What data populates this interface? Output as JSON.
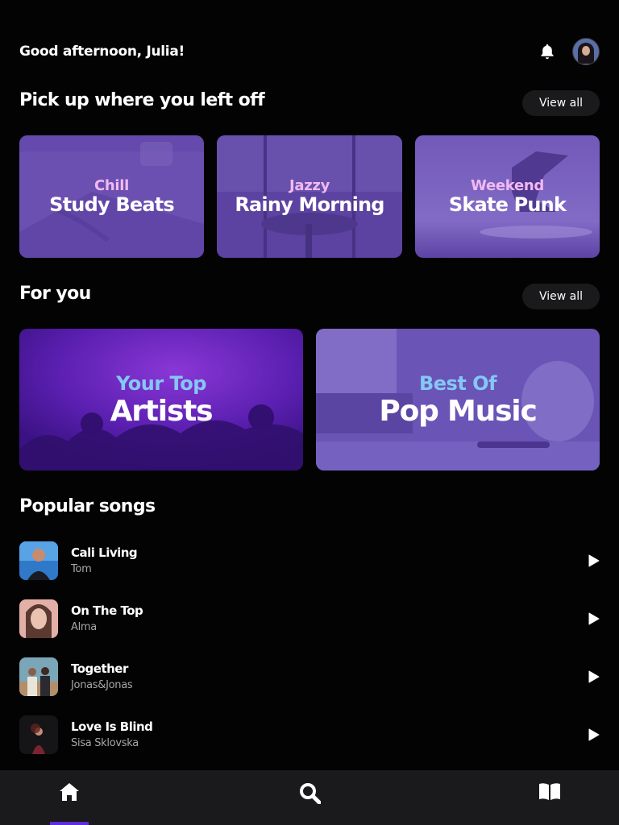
{
  "header": {
    "greeting": "Good afternoon, Julia!",
    "bell_icon": "bell-icon",
    "avatar_icon": "user-avatar"
  },
  "continue": {
    "title": "Pick up where you left off",
    "view_all": "View all",
    "cards": [
      {
        "sub": "Chill",
        "main": "Study Beats"
      },
      {
        "sub": "Jazzy",
        "main": "Rainy Morning"
      },
      {
        "sub": "Weekend",
        "main": "Skate Punk"
      }
    ]
  },
  "for_you": {
    "title": "For you",
    "view_all": "View all",
    "cards": [
      {
        "sub": "Your Top",
        "main": "Artists"
      },
      {
        "sub": "Best Of",
        "main": "Pop Music"
      }
    ]
  },
  "popular": {
    "title": "Popular songs",
    "songs": [
      {
        "title": "Cali Living",
        "artist": "Tom"
      },
      {
        "title": "On The Top",
        "artist": "Alma"
      },
      {
        "title": "Together",
        "artist": "Jonas&Jonas"
      },
      {
        "title": "Love Is Blind",
        "artist": "Sisa Sklovska"
      }
    ]
  },
  "nav": {
    "items": [
      "home-icon",
      "search-icon",
      "library-icon"
    ],
    "active": "home-icon"
  },
  "colors": {
    "background": "#030303",
    "accent": "#5e2ed8",
    "card_overlay": "#5b3ea6",
    "sub_pink": "#f2b9f2",
    "sub_blue": "#85c7f5"
  }
}
